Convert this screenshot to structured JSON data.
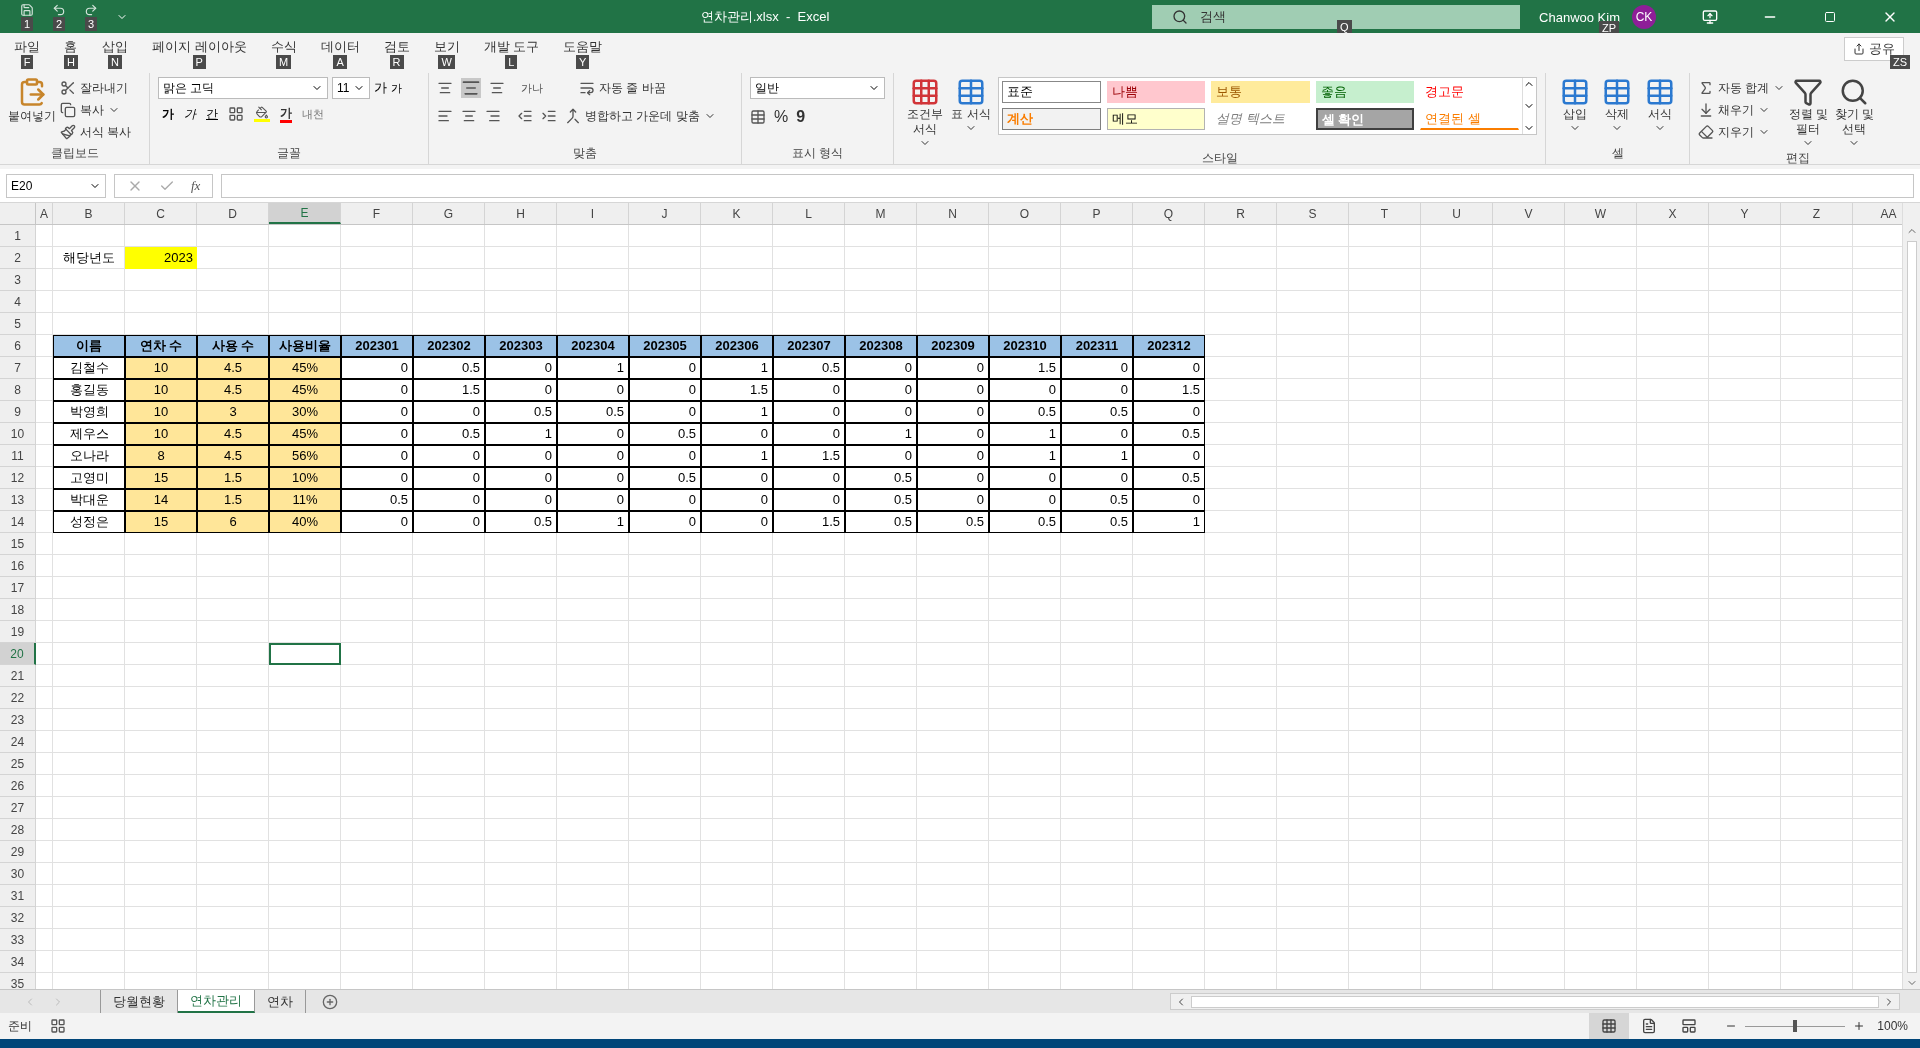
{
  "title_bar": {
    "quick_access_keytips": [
      "1",
      "2",
      "3"
    ],
    "title": "연차관리.xlsx  -  Excel",
    "search": {
      "placeholder": "검색",
      "keytip": "Q"
    },
    "user": {
      "name": "Chanwoo Kim",
      "initials": "CK",
      "keytip": "ZP"
    }
  },
  "ribbon_tabs": [
    {
      "label": "파일",
      "keytip": "F"
    },
    {
      "label": "홈",
      "keytip": "H"
    },
    {
      "label": "삽입",
      "keytip": "N"
    },
    {
      "label": "페이지 레이아웃",
      "keytip": "P"
    },
    {
      "label": "수식",
      "keytip": "M"
    },
    {
      "label": "데이터",
      "keytip": "A"
    },
    {
      "label": "검토",
      "keytip": "R"
    },
    {
      "label": "보기",
      "keytip": "W"
    },
    {
      "label": "개발 도구",
      "keytip": "L"
    },
    {
      "label": "도움말",
      "keytip": "Y"
    }
  ],
  "share": {
    "label": "공유",
    "keytip": "ZS"
  },
  "clipboard": {
    "paste": "붙여넣기",
    "cut": "잘라내기",
    "copy": "복사",
    "format_painter": "서식 복사",
    "label": "클립보드"
  },
  "font": {
    "name": "맑은 고딕",
    "size": "11",
    "grow": "가",
    "shrink": "가",
    "bold": "가",
    "italic": "가",
    "underline": "간",
    "font_color": "가",
    "phonetic": "내천",
    "label": "글꼴"
  },
  "alignment": {
    "orientation": "가나",
    "wrap_text": "자동 줄 바꿈",
    "merge_center": "병합하고 가운데 맞춤",
    "label": "맞춤"
  },
  "number": {
    "format": "일반",
    "percent": "%",
    "comma": "9",
    "label": "표시 형식"
  },
  "styles": {
    "conditional": "조건부 서식",
    "format_table": "표 서식",
    "label": "스타일",
    "gallery": [
      {
        "label": "표준",
        "kind": "normal"
      },
      {
        "label": "나쁨",
        "kind": "bad"
      },
      {
        "label": "보통",
        "kind": "neutral"
      },
      {
        "label": "좋음",
        "kind": "good"
      },
      {
        "label": "경고문",
        "kind": "warning"
      },
      {
        "label": "계산",
        "kind": "calculation"
      },
      {
        "label": "메모",
        "kind": "note"
      },
      {
        "label": "설명 텍스트",
        "kind": "explanatory"
      },
      {
        "label": "셀 확인",
        "kind": "check"
      },
      {
        "label": "연결된 셀",
        "kind": "linked"
      }
    ]
  },
  "cells": {
    "insert": "삽입",
    "delete": "삭제",
    "format": "서식",
    "label": "셀"
  },
  "editing": {
    "autosum": "자동 합계",
    "fill": "채우기",
    "clear": "지우기",
    "sort_filter": "정렬 및 필터",
    "find_select": "찾기 및 선택",
    "label": "편집"
  },
  "formula_bar": {
    "name_box": "E20",
    "fx": "fx"
  },
  "sheet": {
    "columns": [
      {
        "label": "A",
        "selected": false
      },
      {
        "label": "B",
        "selected": false
      },
      {
        "label": "C",
        "selected": false
      },
      {
        "label": "D",
        "selected": false
      },
      {
        "label": "E",
        "selected": true
      },
      {
        "label": "F",
        "selected": false
      },
      {
        "label": "G",
        "selected": false
      },
      {
        "label": "H",
        "selected": false
      },
      {
        "label": "I",
        "selected": false
      },
      {
        "label": "J",
        "selected": false
      },
      {
        "label": "K",
        "selected": false
      },
      {
        "label": "L",
        "selected": false
      },
      {
        "label": "M",
        "selected": false
      },
      {
        "label": "N",
        "selected": false
      },
      {
        "label": "O",
        "selected": false
      },
      {
        "label": "P",
        "selected": false
      },
      {
        "label": "Q",
        "selected": false
      },
      {
        "label": "R",
        "selected": false
      },
      {
        "label": "S",
        "selected": false
      },
      {
        "label": "T",
        "selected": false
      },
      {
        "label": "U",
        "selected": false
      },
      {
        "label": "V",
        "selected": false
      },
      {
        "label": "W",
        "selected": false
      },
      {
        "label": "X",
        "selected": false
      },
      {
        "label": "Y",
        "selected": false
      },
      {
        "label": "Z",
        "selected": false
      },
      {
        "label": "AA",
        "selected": false
      }
    ],
    "rows": [
      {
        "label": "1",
        "selected": false
      },
      {
        "label": "2",
        "selected": false
      },
      {
        "label": "3",
        "selected": false
      },
      {
        "label": "4",
        "selected": false
      },
      {
        "label": "5",
        "selected": false
      },
      {
        "label": "6",
        "selected": false
      },
      {
        "label": "7",
        "selected": false
      },
      {
        "label": "8",
        "selected": false
      },
      {
        "label": "9",
        "selected": false
      },
      {
        "label": "10",
        "selected": false
      },
      {
        "label": "11",
        "selected": false
      },
      {
        "label": "12",
        "selected": false
      },
      {
        "label": "13",
        "selected": false
      },
      {
        "label": "14",
        "selected": false
      },
      {
        "label": "15",
        "selected": false
      },
      {
        "label": "16",
        "selected": false
      },
      {
        "label": "17",
        "selected": false
      },
      {
        "label": "18",
        "selected": false
      },
      {
        "label": "19",
        "selected": false
      },
      {
        "label": "20",
        "selected": true
      },
      {
        "label": "21",
        "selected": false
      },
      {
        "label": "22",
        "selected": false
      },
      {
        "label": "23",
        "selected": false
      },
      {
        "label": "24",
        "selected": false
      },
      {
        "label": "25",
        "selected": false
      },
      {
        "label": "26",
        "selected": false
      },
      {
        "label": "27",
        "selected": false
      },
      {
        "label": "28",
        "selected": false
      },
      {
        "label": "29",
        "selected": false
      },
      {
        "label": "30",
        "selected": false
      },
      {
        "label": "31",
        "selected": false
      },
      {
        "label": "32",
        "selected": false
      },
      {
        "label": "33",
        "selected": false
      },
      {
        "label": "34",
        "selected": false
      },
      {
        "label": "35",
        "selected": false
      }
    ],
    "year_label": "해당년도",
    "year_value": "2023",
    "table": {
      "columns": [
        "이름",
        "연차 수",
        "사용 수",
        "사용비율",
        "202301",
        "202302",
        "202303",
        "202304",
        "202305",
        "202306",
        "202307",
        "202308",
        "202309",
        "202310",
        "202311",
        "202312"
      ],
      "rows": [
        [
          "김철수",
          "10",
          "4.5",
          "45%",
          "0",
          "0.5",
          "0",
          "1",
          "0",
          "1",
          "0.5",
          "0",
          "0",
          "1.5",
          "0",
          "0"
        ],
        [
          "홍길동",
          "10",
          "4.5",
          "45%",
          "0",
          "1.5",
          "0",
          "0",
          "0",
          "1.5",
          "0",
          "0",
          "0",
          "0",
          "0",
          "1.5"
        ],
        [
          "박영희",
          "10",
          "3",
          "30%",
          "0",
          "0",
          "0.5",
          "0.5",
          "0",
          "1",
          "0",
          "0",
          "0",
          "0.5",
          "0.5",
          "0"
        ],
        [
          "제우스",
          "10",
          "4.5",
          "45%",
          "0",
          "0.5",
          "1",
          "0",
          "0.5",
          "0",
          "0",
          "1",
          "0",
          "1",
          "0",
          "0.5"
        ],
        [
          "오나라",
          "8",
          "4.5",
          "56%",
          "0",
          "0",
          "0",
          "0",
          "0",
          "1",
          "1.5",
          "0",
          "0",
          "1",
          "1",
          "0"
        ],
        [
          "고영미",
          "15",
          "1.5",
          "10%",
          "0",
          "0",
          "0",
          "0",
          "0.5",
          "0",
          "0",
          "0.5",
          "0",
          "0",
          "0",
          "0.5"
        ],
        [
          "박대운",
          "14",
          "1.5",
          "11%",
          "0.5",
          "0",
          "0",
          "0",
          "0",
          "0",
          "0",
          "0.5",
          "0",
          "0",
          "0.5",
          "0"
        ],
        [
          "성정은",
          "15",
          "6",
          "40%",
          "0",
          "0",
          "0.5",
          "1",
          "0",
          "0",
          "1.5",
          "0.5",
          "0.5",
          "0.5",
          "0.5",
          "1"
        ]
      ]
    }
  },
  "sheet_tabs": [
    {
      "label": "당월현황",
      "selected": false
    },
    {
      "label": "연차관리",
      "selected": true
    },
    {
      "label": "연차",
      "selected": false
    }
  ],
  "status_bar": {
    "status": "준비",
    "views": [
      {
        "kind": "normal",
        "selected": true
      },
      {
        "kind": "page_layout",
        "selected": false
      },
      {
        "kind": "page_break",
        "selected": false
      }
    ],
    "zoom": {
      "level": 0.5,
      "reading": "100%"
    }
  }
}
